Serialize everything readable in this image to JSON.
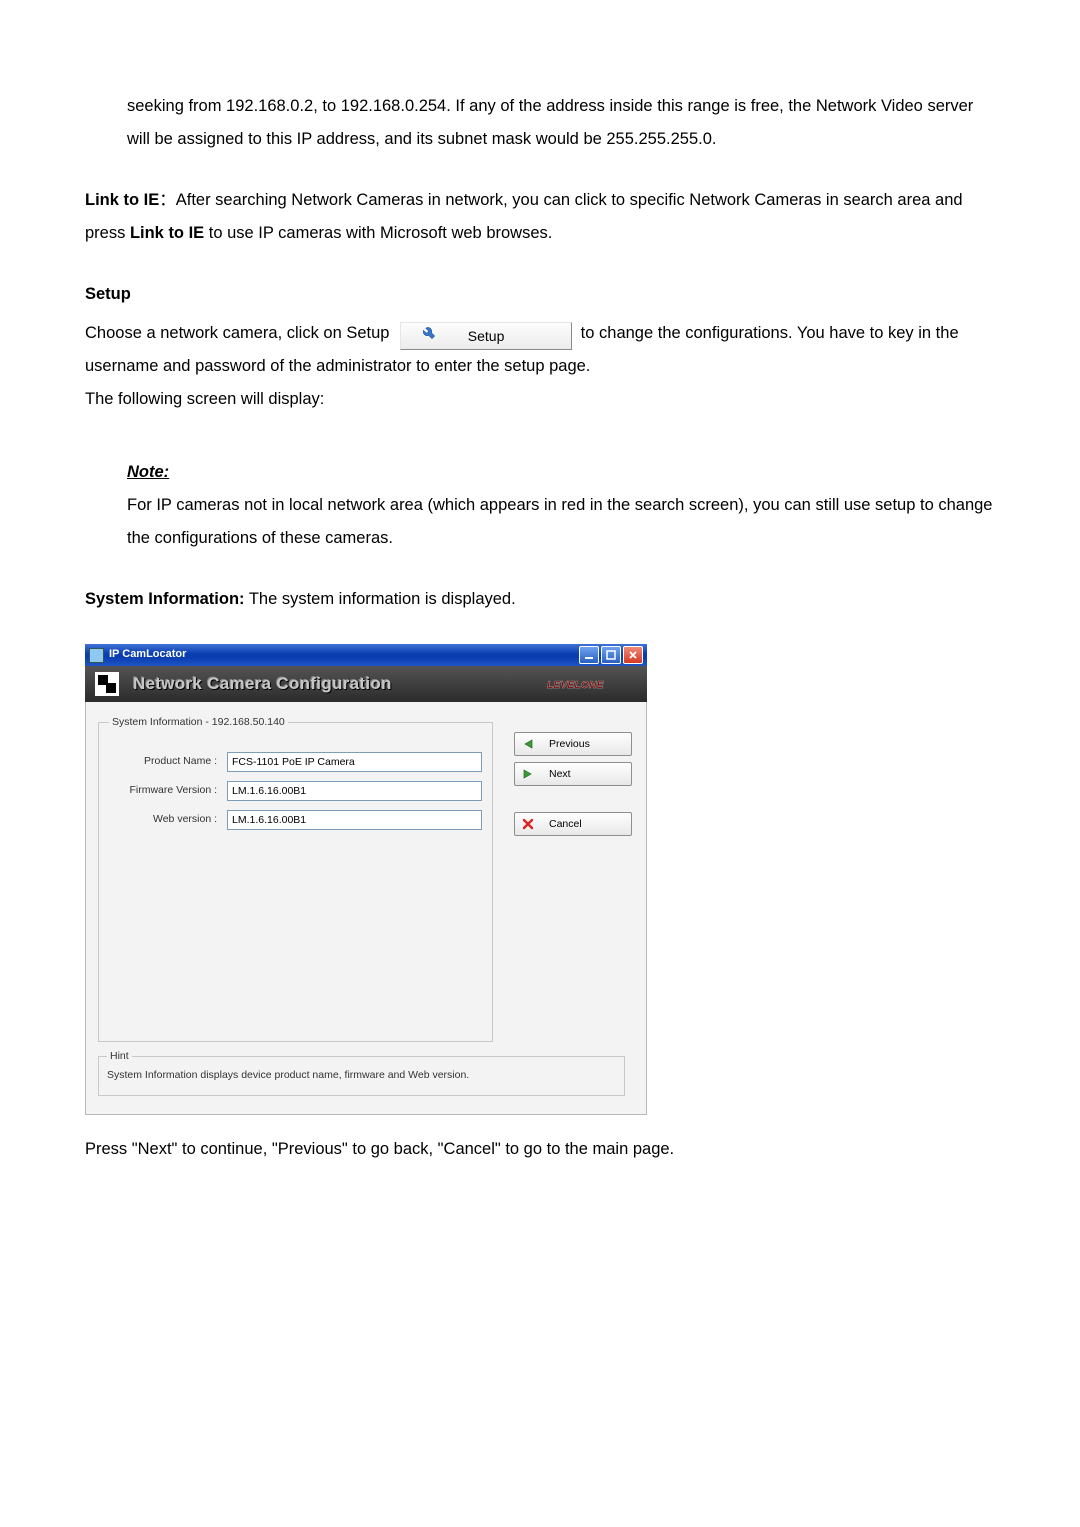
{
  "text": {
    "p1": "seeking from 192.168.0.2, to 192.168.0.254. If any of the address inside this range is free, the Network Video server will be assigned to this IP address, and its subnet mask would be 255.255.255.0.",
    "link_to_ie_label": "Link to IE",
    "link_to_ie_sep": "：",
    "link_to_ie_body_a": "After searching Network Cameras in network, you can click to specific Network Cameras in search area and press ",
    "link_to_ie_bold": "Link to IE",
    "link_to_ie_body_b": " to use IP cameras with Microsoft web browses.",
    "setup_heading": "Setup",
    "setup_line_a": "Choose a network camera, click on Setup ",
    "setup_button_label": "Setup",
    "setup_line_b": " to change the configurations. You have to key in the username and password of the administrator to enter the setup page.",
    "setup_line_c": "The following screen will display:",
    "note_head": "Note:",
    "note_body": "For IP cameras not in local network area (which appears in red in the search screen), you can still use setup to change the configurations of these cameras.",
    "sysinfo_label": "System Information:",
    "sysinfo_text": " The system information is displayed.",
    "footer": "Press \"Next\" to continue, \"Previous\" to go back, \"Cancel\" to go to the main page."
  },
  "window": {
    "title": "IP CamLocator",
    "banner_title": "Network Camera Configuration",
    "brand": "LEVELONE",
    "sysinfo_legend": "System Information - 192.168.50.140",
    "rows": {
      "product_label": "Product Name :",
      "product_value": "FCS-1101 PoE IP Camera",
      "firmware_label": "Firmware Version :",
      "firmware_value": "LM.1.6.16.00B1",
      "web_label": "Web version :",
      "web_value": "LM.1.6.16.00B1"
    },
    "hint_legend": "Hint",
    "hint_text": "System Information displays device product name, firmware and Web version.",
    "buttons": {
      "previous": "Previous",
      "next": "Next",
      "cancel": "Cancel"
    }
  }
}
